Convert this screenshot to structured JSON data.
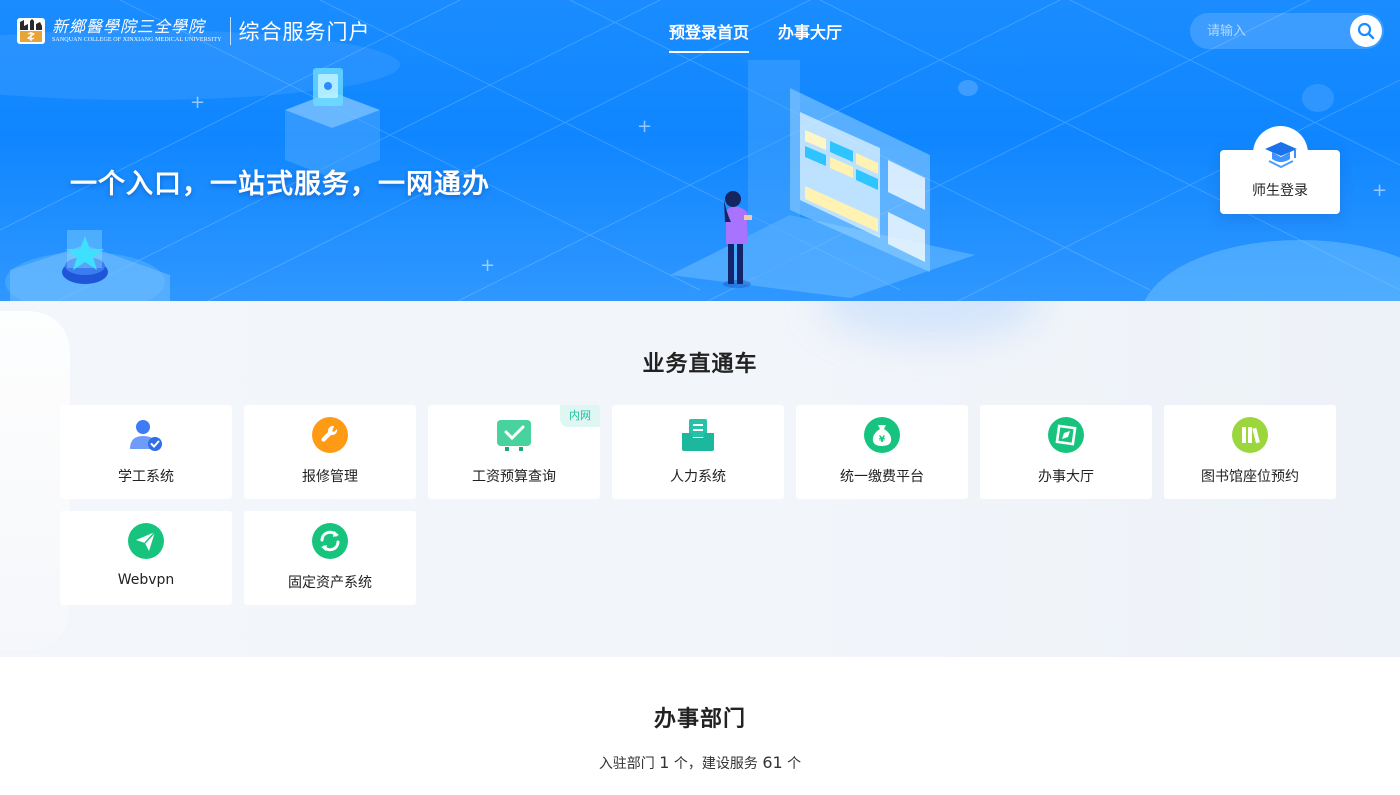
{
  "header": {
    "logo_cn": "新鄉醫學院三全學院",
    "logo_en": "SANQUAN COLLEGE OF XINXIANG MEDICAL UNIVERSITY",
    "portal_name": "综合服务门户",
    "nav": [
      {
        "label": "预登录首页",
        "active": true
      },
      {
        "label": "办事大厅",
        "active": false
      }
    ],
    "search_placeholder": "请输入"
  },
  "hero": {
    "slogan": "一个入口，一站式服务，一网通办",
    "login_label": "师生登录"
  },
  "business": {
    "title": "业务直通车",
    "cards": [
      {
        "label": "学工系统",
        "icon": "student-user-icon",
        "color": "#3d7cf5"
      },
      {
        "label": "报修管理",
        "icon": "wrench-icon",
        "color": "#ff9a14"
      },
      {
        "label": "工资预算查询",
        "icon": "monitor-check-icon",
        "color": "#2ec98f",
        "tag": "内网"
      },
      {
        "label": "人力系统",
        "icon": "inbox-icon",
        "color": "#25c1a8"
      },
      {
        "label": "统一缴费平台",
        "icon": "money-bag-icon",
        "color": "#16c47f"
      },
      {
        "label": "办事大厅",
        "icon": "compass-icon",
        "color": "#18c47d"
      },
      {
        "label": "图书馆座位预约",
        "icon": "books-icon",
        "color": "#9bd63d"
      },
      {
        "label": "Webvpn",
        "icon": "paper-plane-icon",
        "color": "#17c47d"
      },
      {
        "label": "固定资产系统",
        "icon": "refresh-icon",
        "color": "#17c47d"
      }
    ]
  },
  "departments": {
    "title": "办事部门",
    "text_before": "入驻部门",
    "dept_count": "1",
    "text_mid": "个，建设服务",
    "service_count": "61",
    "text_after": "个"
  }
}
